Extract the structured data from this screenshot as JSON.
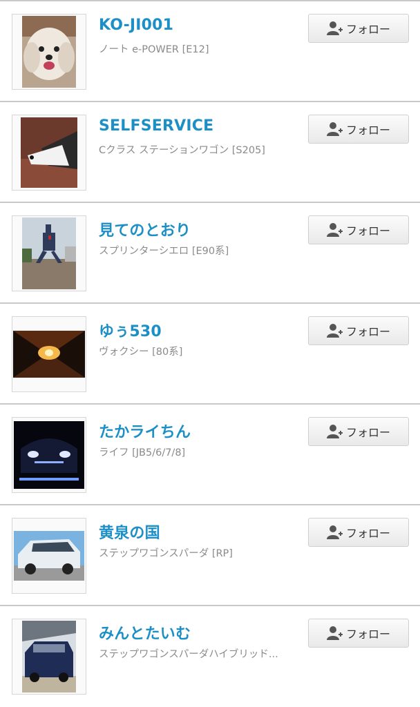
{
  "follow_label": "フォロー",
  "colors": {
    "name": "#1c8fc7",
    "car": "#8a8a8a",
    "divider": "#c8c8c8"
  },
  "users": [
    {
      "name": "KO-JI001",
      "car": "ノート e-POWER [E12]",
      "avatar": "dog-photo"
    },
    {
      "name": "SELFSERVICE",
      "car": "Cクラス ステーションワゴン [S205]",
      "avatar": "husky-photo"
    },
    {
      "name": "見てのとおり",
      "car": "スプリンターシエロ [E90系]",
      "avatar": "statue-photo"
    },
    {
      "name": "ゆぅ530",
      "car": "ヴォクシー [80系]",
      "avatar": "tunnel-photo"
    },
    {
      "name": "たかライちん",
      "car": "ライフ [JB5/6/7/8]",
      "avatar": "car-lights-photo"
    },
    {
      "name": "黄泉の国",
      "car": "ステップワゴンスパーダ [RP]",
      "avatar": "white-van-photo"
    },
    {
      "name": "みんとたいむ",
      "car": "ステップワゴンスパーダハイブリッド...",
      "avatar": "garage-van-photo"
    }
  ]
}
